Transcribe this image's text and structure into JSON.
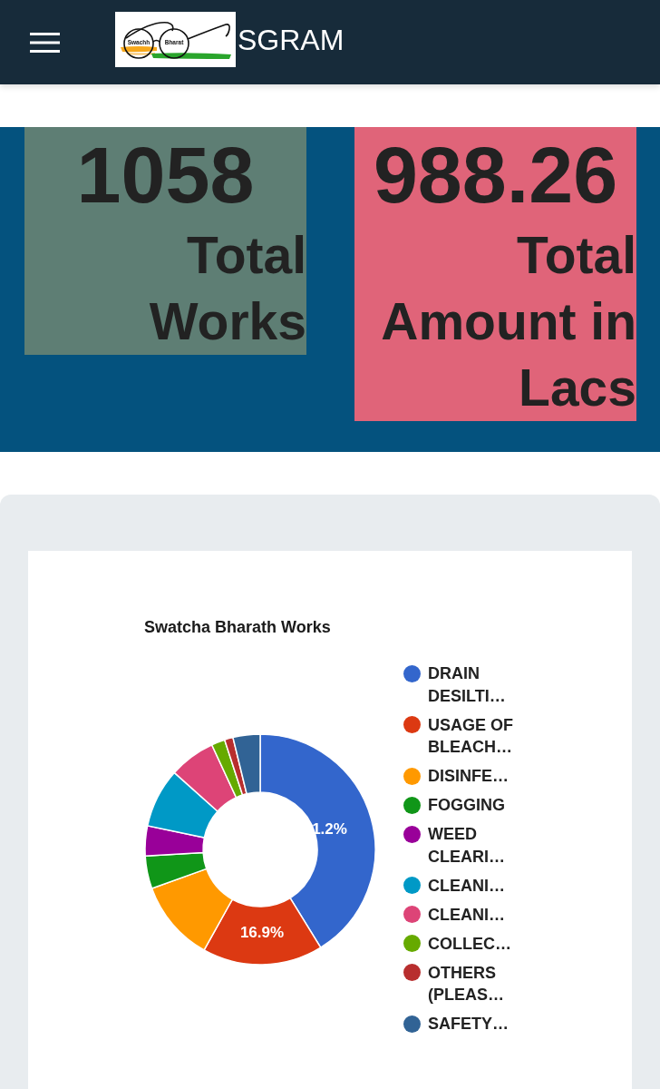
{
  "header": {
    "logo_text": [
      "Swachh",
      "Bharat"
    ],
    "title": "SGRAM"
  },
  "stats": [
    {
      "value": "1058",
      "label": "Total Works",
      "color": "#5e7e74"
    },
    {
      "value": "988.26",
      "label": "Total Amount in Lacs",
      "color": "#e06479"
    }
  ],
  "chart_panel": {
    "chart_data": {
      "type": "donut",
      "title": "Swatcha Bharath Works",
      "legend": "right",
      "categories": [
        "DRAIN DESILTI…",
        "USAGE OF BLEACH…",
        "DISINFE…",
        "FOGGING",
        "WEED CLEARI…",
        "CLEANI…",
        "CLEANI…",
        "COLLEC…",
        "OTHERS (PLEAS…",
        "SAFETY…"
      ],
      "values": [
        41.2,
        16.9,
        11.4,
        4.6,
        4.2,
        8.3,
        6.5,
        1.9,
        1.2,
        3.8
      ],
      "colors": [
        "#3366cc",
        "#dc3912",
        "#ff9900",
        "#109618",
        "#990099",
        "#0099c6",
        "#dd4477",
        "#66aa00",
        "#b82e2e",
        "#316395"
      ]
    },
    "slice_labels": [
      {
        "text": "1.2%"
      },
      {
        "text": "16.9%"
      }
    ]
  }
}
